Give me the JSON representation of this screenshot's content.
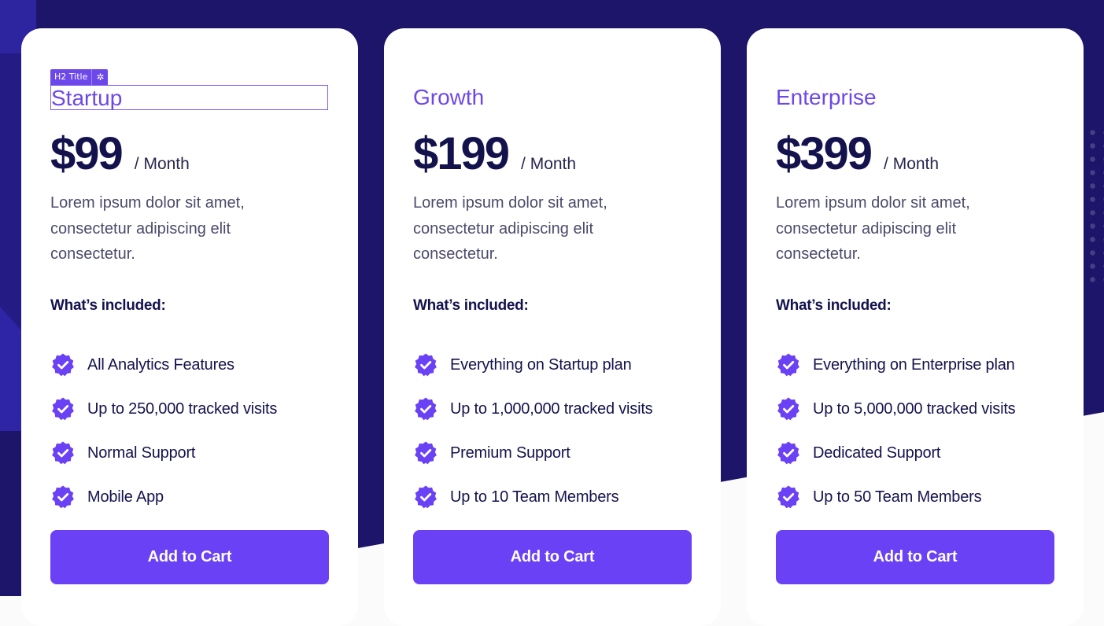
{
  "colors": {
    "navy": "#1c1569",
    "accent": "#6a41f5",
    "title": "#6c47ea",
    "card": "#ffffff"
  },
  "editor_chip": {
    "label": "H2 Title",
    "icon": "gear-icon"
  },
  "plans": [
    {
      "title": "Startup",
      "price": "$99",
      "period": "/ Month",
      "description": "Lorem ipsum dolor sit amet, consectetur adipiscing elit consectetur.",
      "included_label": "What’s included:",
      "features": [
        "All Analytics Features",
        "Up to 250,000 tracked visits",
        "Normal Support",
        "Mobile App"
      ],
      "button": "Add to Cart"
    },
    {
      "title": "Growth",
      "price": "$199",
      "period": "/ Month",
      "description": "Lorem ipsum dolor sit amet, consectetur adipiscing elit consectetur.",
      "included_label": "What’s included:",
      "features": [
        "Everything on Startup plan",
        "Up to 1,000,000 tracked visits",
        "Premium Support",
        "Up to 10 Team Members"
      ],
      "button": "Add to Cart"
    },
    {
      "title": "Enterprise",
      "price": "$399",
      "period": "/ Month",
      "description": "Lorem ipsum dolor sit amet, consectetur adipiscing elit consectetur.",
      "included_label": "What’s included:",
      "features": [
        "Everything on Enterprise plan",
        "Up to 5,000,000 tracked visits",
        "Dedicated Support",
        "Up to 50 Team Members"
      ],
      "button": "Add to Cart"
    }
  ]
}
